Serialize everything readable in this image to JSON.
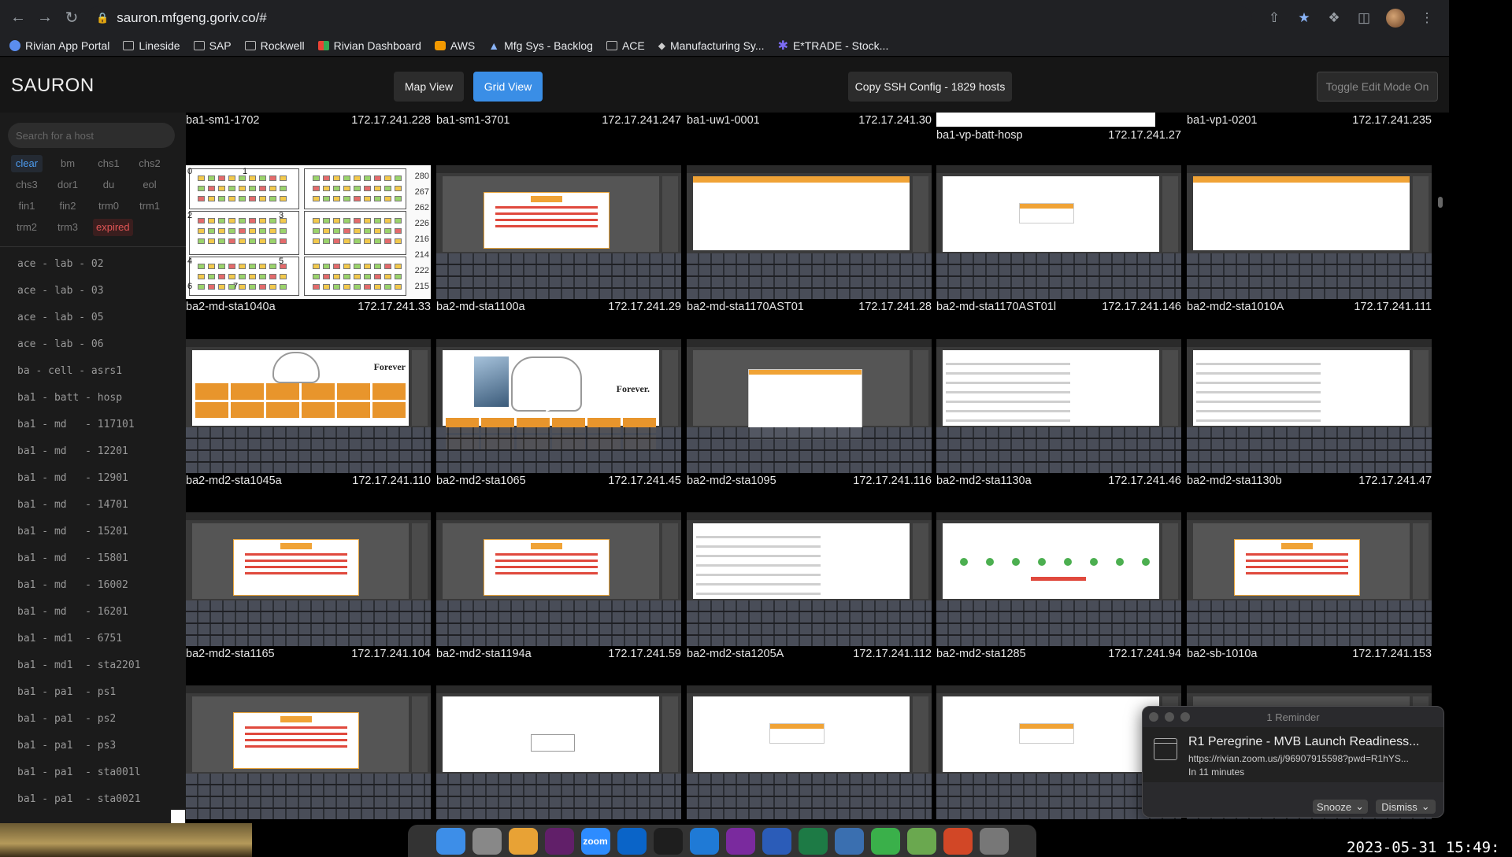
{
  "browser": {
    "url": "sauron.mfgeng.goriv.co/#",
    "bookmarks": [
      {
        "label": "Rivian App Portal",
        "icon": "rivian-icon"
      },
      {
        "label": "Lineside",
        "icon": "folder-icon"
      },
      {
        "label": "SAP",
        "icon": "folder-icon"
      },
      {
        "label": "Rockwell",
        "icon": "folder-icon"
      },
      {
        "label": "Rivian Dashboard",
        "icon": "grid-icon"
      },
      {
        "label": "AWS",
        "icon": "aws-icon"
      },
      {
        "label": "Mfg Sys - Backlog",
        "icon": "git-icon"
      },
      {
        "label": "ACE",
        "icon": "folder-icon"
      },
      {
        "label": "Manufacturing Sy...",
        "icon": "diamond-icon"
      },
      {
        "label": "E*TRADE - Stock...",
        "icon": "etrade-icon"
      }
    ]
  },
  "app": {
    "brand": "SAURON",
    "map_view": "Map View",
    "grid_view": "Grid View",
    "ssh_config": "Copy SSH Config - 1829 hosts",
    "toggle_edit": "Toggle Edit Mode On",
    "accent": "#3a8ee6"
  },
  "sidebar": {
    "search_placeholder": "Search for a host",
    "filters": [
      "clear",
      "bm",
      "chs1",
      "chs2",
      "chs3",
      "dor1",
      "du",
      "eol",
      "fin1",
      "fin2",
      "trm0",
      "trm1",
      "trm2",
      "trm3",
      "expired"
    ],
    "hosts": [
      "ace - lab - 02",
      "ace - lab - 03",
      "ace - lab - 05",
      "ace - lab - 06",
      "ba - cell - asrs1",
      "ba1 - batt - hosp",
      "ba1 - md   - 117101",
      "ba1 - md   - 12201",
      "ba1 - md   - 12901",
      "ba1 - md   - 14701",
      "ba1 - md   - 15201",
      "ba1 - md   - 15801",
      "ba1 - md   - 16002",
      "ba1 - md   - 16201",
      "ba1 - md1  - 6751",
      "ba1 - md1  - sta2201",
      "ba1 - pa1  - ps1",
      "ba1 - pa1  - ps2",
      "ba1 - pa1  - ps3",
      "ba1 - pa1  - sta001l",
      "ba1 - pa1  - sta0021"
    ]
  },
  "grid": {
    "top_row": [
      {
        "name": "ba1-sm1-1702",
        "ip": "172.17.241.228"
      },
      {
        "name": "ba1-sm1-3701",
        "ip": "172.17.241.247"
      },
      {
        "name": "ba1-uw1-0001",
        "ip": "172.17.241.30"
      },
      {
        "name": "ba1-vp-batt-hosp",
        "ip": "172.17.241.27"
      },
      {
        "name": "ba1-vp1-0201",
        "ip": "172.17.241.235"
      }
    ],
    "rows": [
      [
        {
          "name": "ba2-md-sta1040a",
          "ip": "172.17.241.33",
          "kind": "schematic"
        },
        {
          "name": "ba2-md-sta1100a",
          "ip": "172.17.241.29",
          "kind": "alert"
        },
        {
          "name": "ba2-md-sta1170AST01",
          "ip": "172.17.241.28",
          "kind": "blank"
        },
        {
          "name": "ba2-md-sta1170AST01l",
          "ip": "172.17.241.146",
          "kind": "dialog"
        },
        {
          "name": "ba2-md2-sta1010A",
          "ip": "172.17.241.111",
          "kind": "blank"
        }
      ],
      [
        {
          "name": "ba2-md2-sta1045a",
          "ip": "172.17.241.110",
          "kind": "forever"
        },
        {
          "name": "ba2-md2-sta1065",
          "ip": "172.17.241.45",
          "kind": "forever2"
        },
        {
          "name": "ba2-md2-sta1095",
          "ip": "172.17.241.116",
          "kind": "graydialog"
        },
        {
          "name": "ba2-md2-sta1130a",
          "ip": "172.17.241.46",
          "kind": "form"
        },
        {
          "name": "ba2-md2-sta1130b",
          "ip": "172.17.241.47",
          "kind": "form"
        }
      ],
      [
        {
          "name": "ba2-md2-sta1165",
          "ip": "172.17.241.104",
          "kind": "alert"
        },
        {
          "name": "ba2-md2-sta1194a",
          "ip": "172.17.241.59",
          "kind": "alert"
        },
        {
          "name": "ba2-md2-sta1205A",
          "ip": "172.17.241.112",
          "kind": "form"
        },
        {
          "name": "ba2-md2-sta1285",
          "ip": "172.17.241.94",
          "kind": "dots"
        },
        {
          "name": "ba2-sb-1010a",
          "ip": "172.17.241.153",
          "kind": "alert"
        }
      ],
      [
        {
          "name": "",
          "ip": "",
          "kind": "alert"
        },
        {
          "name": "",
          "ip": "",
          "kind": "login"
        },
        {
          "name": "",
          "ip": "",
          "kind": "dialog"
        },
        {
          "name": "",
          "ip": "",
          "kind": "dialog"
        },
        {
          "name": "",
          "ip": "",
          "kind": "alert"
        }
      ]
    ],
    "thumb_text": {
      "forever": "Forever",
      "forever2": "Forever.",
      "schem_nums": [
        "280",
        "267",
        "262",
        "226",
        "216",
        "214",
        "222",
        "215"
      ],
      "schem_labels": [
        "0",
        "1",
        "2",
        "3",
        "4",
        "5",
        "6",
        "7"
      ]
    }
  },
  "reminder": {
    "title": "1 Reminder",
    "subject": "R1 Peregrine - MVB Launch Readiness...",
    "url": "https://rivian.zoom.us/j/96907915598?pwd=R1hYS...",
    "time": "In 11 minutes",
    "snooze": "Snooze",
    "dismiss": "Dismiss"
  },
  "dock": [
    "finder-icon",
    "launchpad-icon",
    "chrome-icon",
    "slack-icon",
    "zoom-icon",
    "outlook-icon",
    "terminal-icon",
    "vscode-icon",
    "onenote-icon",
    "word-icon",
    "excel-icon",
    "remote-desktop-icon",
    "cloud-icon",
    "vpn-icon",
    "powerpoint-icon",
    "trash-icon"
  ],
  "dock_labels": {
    "zoom": "zoom"
  },
  "timestamp": "2023-05-31 15:49:"
}
